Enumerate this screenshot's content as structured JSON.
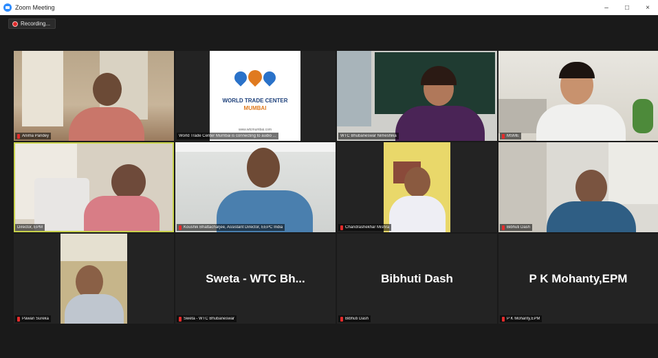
{
  "window": {
    "title": "Zoom Meeting"
  },
  "controls": {
    "minimize": "–",
    "maximize": "□",
    "close": "×"
  },
  "recording": {
    "label": "Recording..."
  },
  "logo": {
    "line1": "WORLD TRADE CENTER",
    "line2": "MUMBAI",
    "url": "www.wtcmumbai.com"
  },
  "participants": [
    {
      "name": "Anima Pandey",
      "muted": true,
      "video": true
    },
    {
      "name": "World Trade Center Mumbai is connecting to audio ...",
      "muted": false,
      "video": true
    },
    {
      "name": "WTC Bhubaneswar Nimeshika",
      "muted": false,
      "video": true
    },
    {
      "name": "MSME",
      "muted": true,
      "video": true
    },
    {
      "name": "Director, EPM",
      "muted": false,
      "video": true,
      "active_speaker": true
    },
    {
      "name": "Koushik Bhattacharjee, Assistant Director, EEPC India",
      "muted": true,
      "video": true
    },
    {
      "name": "Chandrashekhar Mishra",
      "muted": true,
      "video": true
    },
    {
      "name": "Bibhuti Dash",
      "muted": true,
      "video": true
    },
    {
      "name": "Pawan Sureka",
      "muted": true,
      "video": true
    },
    {
      "name": "Sweta - WTC Bhubaneswar",
      "display": "Sweta - WTC Bh...",
      "muted": true,
      "video": false
    },
    {
      "name": "Bibhuti Dash",
      "display": "Bibhuti Dash",
      "muted": true,
      "video": false
    },
    {
      "name": "P K Mohanty,EPM",
      "display": "P K Mohanty,EPM",
      "muted": true,
      "video": false
    }
  ]
}
